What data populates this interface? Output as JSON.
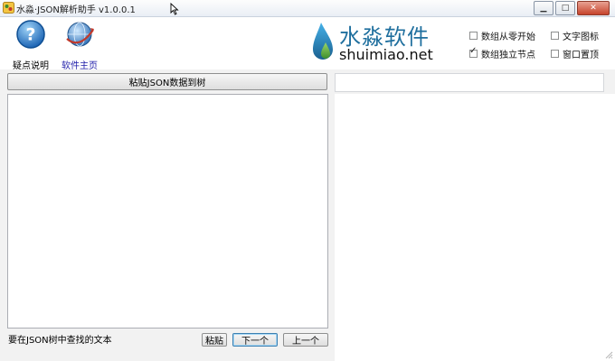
{
  "window": {
    "title": "水淼·JSON解析助手 v1.0.0.1",
    "controls": {
      "minimize": "▁",
      "maximize": "□",
      "close": "✕"
    }
  },
  "toolbar": {
    "help": {
      "label": "疑点说明",
      "icon": "question-icon"
    },
    "home": {
      "label": "软件主页",
      "icon": "globe-icon"
    }
  },
  "logo": {
    "cn": "水淼软件",
    "en": "shuimiao.net",
    "icon": "water-drop-logo"
  },
  "options": [
    {
      "label": "数组从零开始",
      "checked": false
    },
    {
      "label": "文字图标",
      "checked": false
    },
    {
      "label": "数组独立节点",
      "checked": true
    },
    {
      "label": "窗口置顶",
      "checked": false
    }
  ],
  "main": {
    "paste_button": "粘贴JSON数据到树",
    "json_input_value": "",
    "path_value": ""
  },
  "search": {
    "value": "要在JSON树中查找的文本",
    "paste": "粘贴",
    "next": "下一个",
    "prev": "上一个"
  },
  "colors": {
    "brand": "#1f6f9e",
    "link": "#1d1ba8"
  }
}
